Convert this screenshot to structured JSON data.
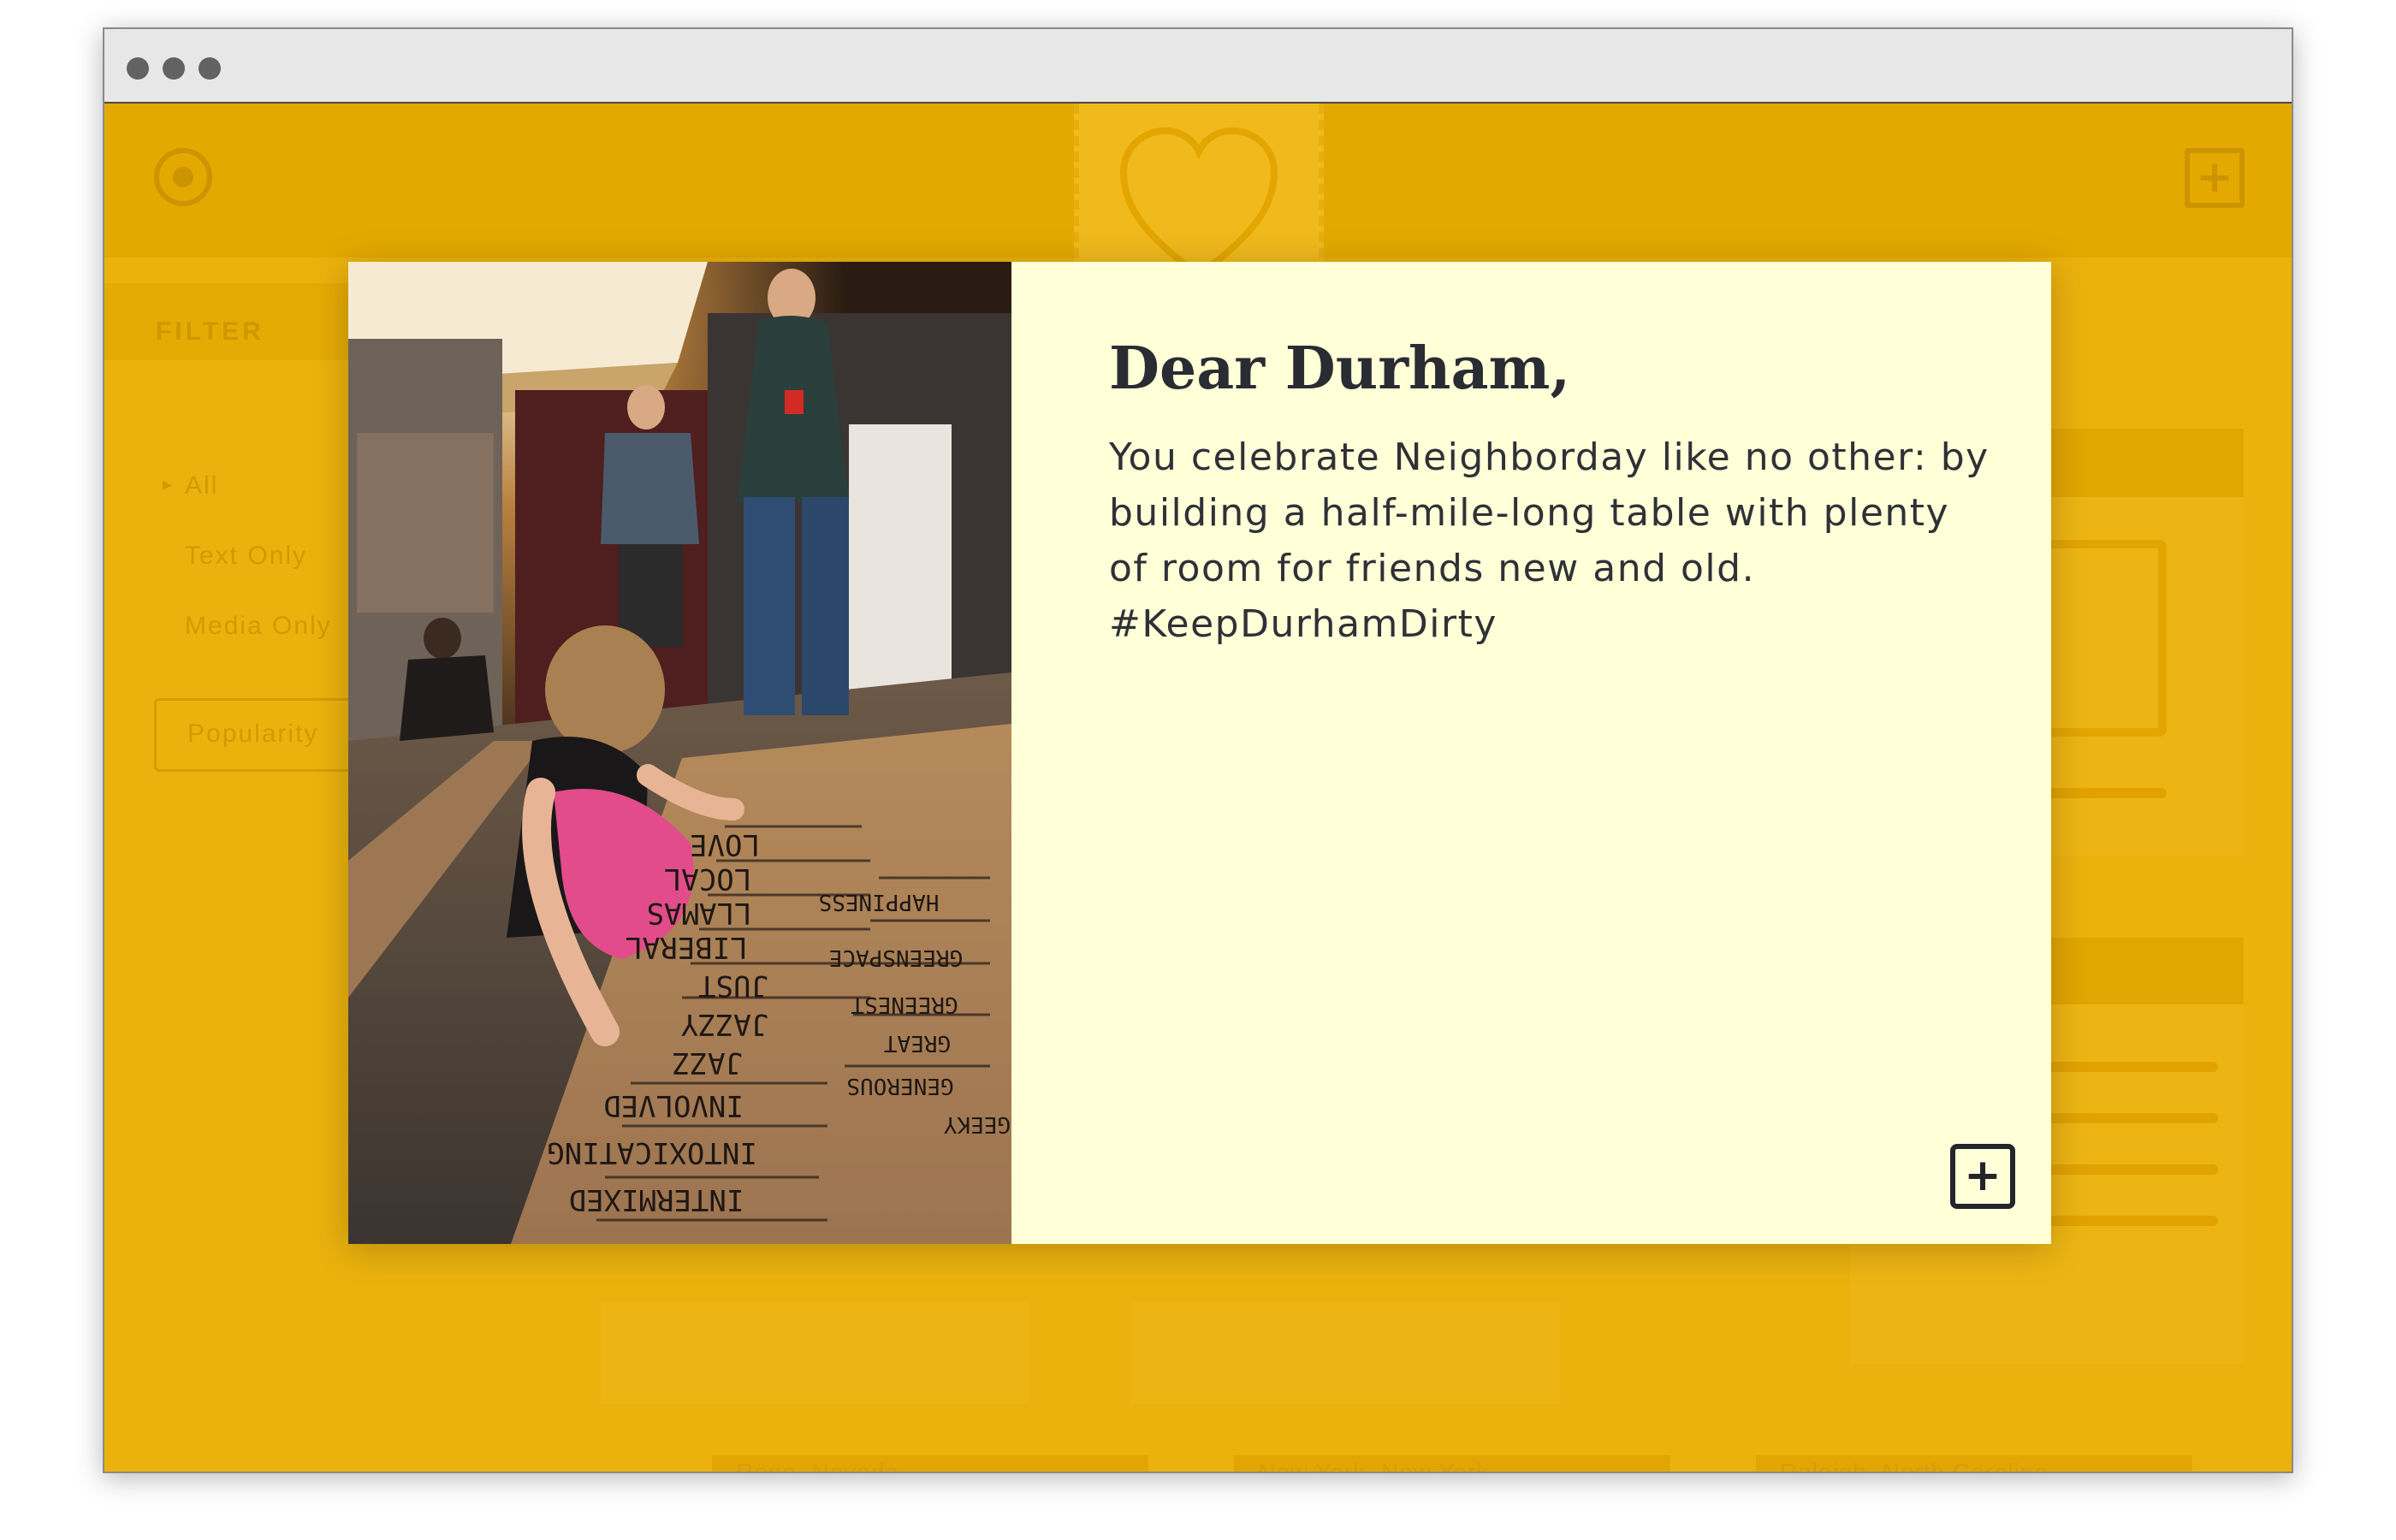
{
  "app": {
    "sidebar": {
      "filter_heading": "FILTER",
      "filter_options": [
        "All",
        "Text Only",
        "Media Only"
      ],
      "sort_label": "Popularity"
    },
    "background_captions": [
      "Reno, Nevada",
      "New York, New York",
      "Raleigh, North Carolina"
    ],
    "background_partial_caption": "olina"
  },
  "modal": {
    "title": "Dear Durham,",
    "body": "You celebrate Neighborday like no other: by building a half-mile-long table with plenty of room for friends new and old. #KeepDurhamDirty",
    "photo_words": [
      "INTERMIXED",
      "INTOXICATING",
      "INVOLVED",
      "JAZZ",
      "JAZZY",
      "JUST",
      "LIBERAL",
      "LLAMAS",
      "LOCAL",
      "LOVE",
      "GENEROUS",
      "GREAT",
      "GREENEST",
      "GREENSPACE",
      "HAPPINESS",
      "GEEKY"
    ],
    "expand_symbol": "+"
  },
  "colors": {
    "background": "#ebb20e",
    "card": "#ffffd8",
    "text": "#2a2c33"
  },
  "icons": [
    "window-dot-icon",
    "circle-target-icon",
    "heart-stamp-icon",
    "plus-box-icon",
    "caret-right-icon"
  ]
}
